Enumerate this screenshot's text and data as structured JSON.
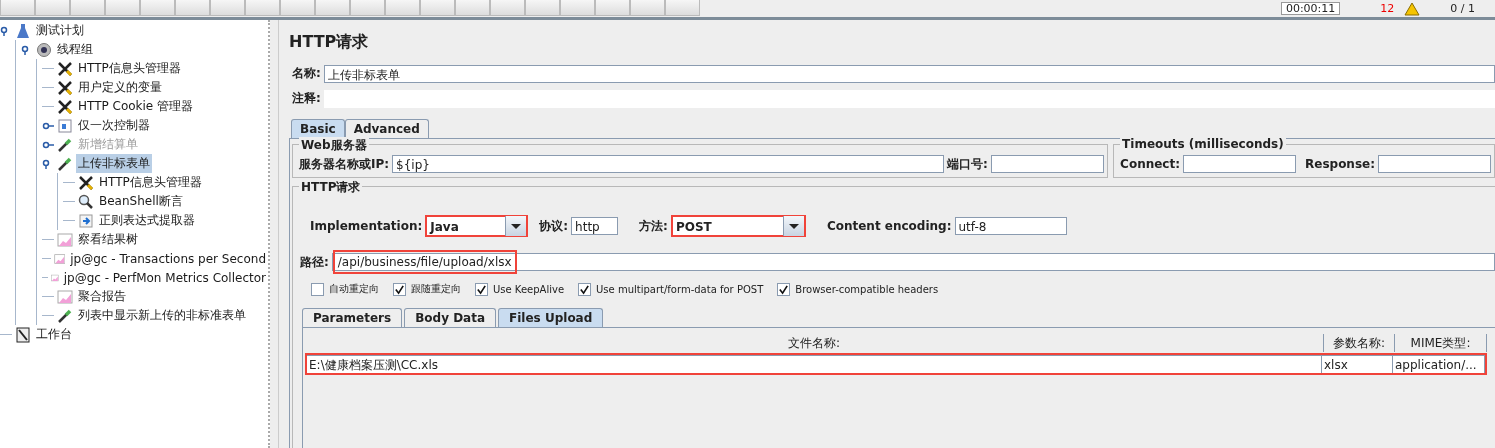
{
  "toolbar": {
    "timer": "00:00:11",
    "warnings": "12",
    "threads": "0 / 1"
  },
  "tree": [
    {
      "label": "测试计划",
      "kind": "plan",
      "expanded": true,
      "selected": false,
      "disabled": false,
      "children": [
        {
          "label": "线程组",
          "kind": "gear",
          "expanded": true,
          "selected": false,
          "disabled": false,
          "children": [
            {
              "label": "HTTP信息头管理器",
              "kind": "tools",
              "selected": false,
              "disabled": false
            },
            {
              "label": "用户定义的变量",
              "kind": "tools",
              "selected": false,
              "disabled": false
            },
            {
              "label": "HTTP Cookie 管理器",
              "kind": "tools",
              "selected": false,
              "disabled": false
            },
            {
              "label": "仅一次控制器",
              "kind": "controller",
              "expanded": false,
              "selected": false,
              "disabled": false
            },
            {
              "label": "新增结算单",
              "kind": "sampler",
              "expanded": false,
              "selected": false,
              "disabled": true
            },
            {
              "label": "上传非标表单",
              "kind": "sampler",
              "expanded": true,
              "selected": true,
              "disabled": false,
              "children": [
                {
                  "label": "HTTP信息头管理器",
                  "kind": "tools",
                  "selected": false,
                  "disabled": false
                },
                {
                  "label": "BeanShell断言",
                  "kind": "assertion",
                  "selected": false,
                  "disabled": false
                },
                {
                  "label": "正则表达式提取器",
                  "kind": "extractor",
                  "selected": false,
                  "disabled": false
                }
              ]
            },
            {
              "label": "察看结果树",
              "kind": "listener",
              "selected": false,
              "disabled": false
            },
            {
              "label": "jp@gc - Transactions per Second",
              "kind": "listener",
              "selected": false,
              "disabled": false
            },
            {
              "label": "jp@gc - PerfMon Metrics Collector",
              "kind": "listener",
              "selected": false,
              "disabled": false
            },
            {
              "label": "聚合报告",
              "kind": "listener",
              "selected": false,
              "disabled": false
            },
            {
              "label": "列表中显示新上传的非标准表单",
              "kind": "sampler",
              "selected": false,
              "disabled": false
            }
          ]
        }
      ]
    },
    {
      "label": "工作台",
      "kind": "workbench",
      "selected": false,
      "disabled": false
    }
  ],
  "title": "HTTP请求",
  "name_field": {
    "label": "名称:",
    "value": "上传非标表单"
  },
  "comment_field": {
    "label": "注释:"
  },
  "tabs": [
    {
      "label": "Basic",
      "selected": true
    },
    {
      "label": "Advanced",
      "selected": false
    }
  ],
  "web_server": {
    "legend": "Web服务器",
    "server_label": "服务器名称或IP:",
    "server_value": "${ip}",
    "port_label": "端口号:"
  },
  "timeouts": {
    "legend": "Timeouts (milliseconds)",
    "connect_label": "Connect:",
    "response_label": "Response:"
  },
  "http_request": {
    "legend": "HTTP请求",
    "implementation": {
      "label": "Implementation:",
      "value": "Java",
      "highlighted": true
    },
    "protocol": {
      "label": "协议:",
      "value": "http"
    },
    "method": {
      "label": "方法:",
      "value": "POST",
      "highlighted": true
    },
    "encoding": {
      "label": "Content encoding:",
      "value": "utf-8"
    },
    "path": {
      "label": "路径:",
      "value": "/api/business/file/upload/xlsx",
      "highlighted": true
    },
    "options": [
      {
        "label": "自动重定向",
        "checked": false
      },
      {
        "label": "跟随重定向",
        "checked": true
      },
      {
        "label": "Use KeepAlive",
        "checked": true
      },
      {
        "label": "Use multipart/form-data for POST",
        "checked": true
      },
      {
        "label": "Browser-compatible headers",
        "checked": true
      }
    ]
  },
  "sub_tabs": [
    {
      "label": "Parameters",
      "selected": false
    },
    {
      "label": "Body Data",
      "selected": false
    },
    {
      "label": "Files Upload",
      "selected": true
    }
  ],
  "files_table": {
    "columns": [
      "文件名称:",
      "参数名称:",
      "MIME类型:"
    ],
    "rows": [
      {
        "cells": [
          "E:\\健康档案压测\\CC.xls",
          "xlsx",
          "application/..."
        ],
        "highlighted": true
      }
    ]
  }
}
